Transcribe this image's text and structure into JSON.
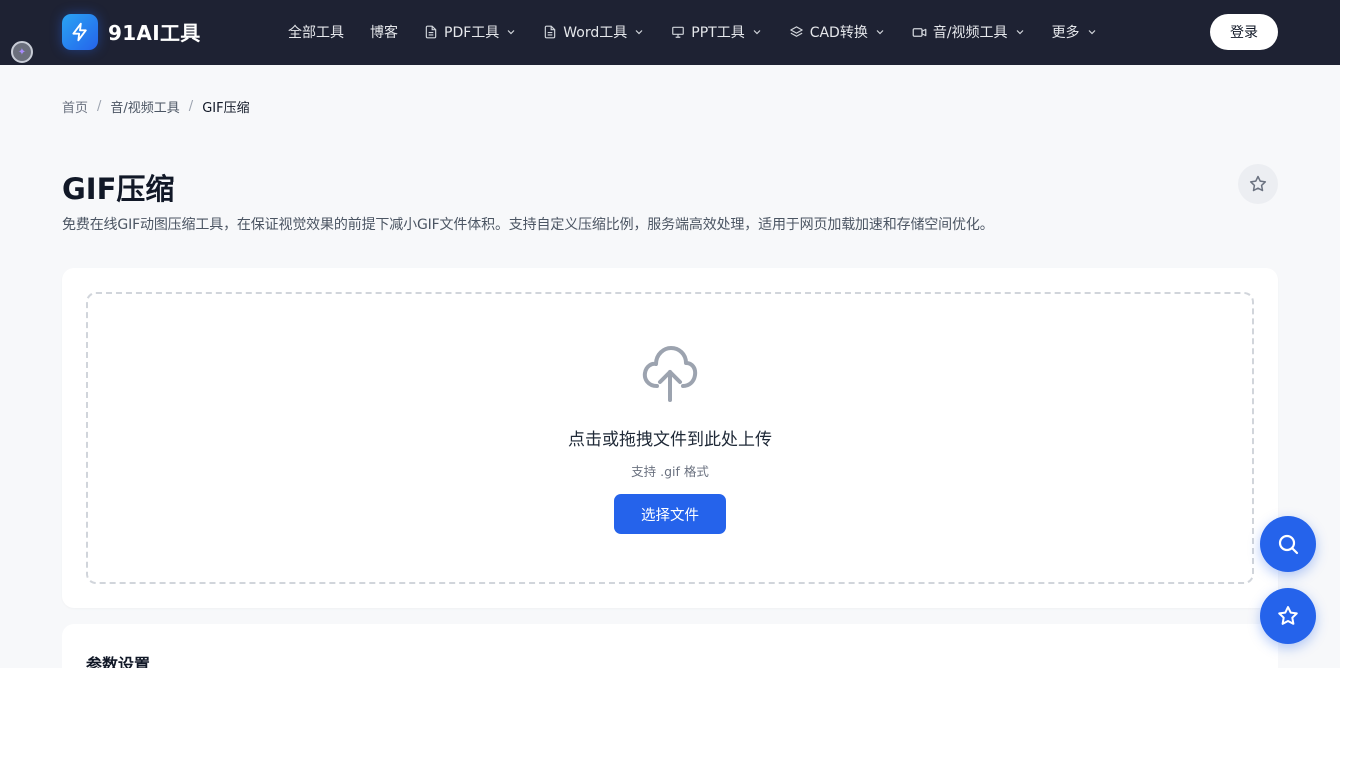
{
  "header": {
    "brand": "91AI工具",
    "nav": [
      {
        "label": "全部工具",
        "icon": null,
        "dropdown": false
      },
      {
        "label": "博客",
        "icon": null,
        "dropdown": false
      },
      {
        "label": "PDF工具",
        "icon": "document-icon",
        "dropdown": true
      },
      {
        "label": "Word工具",
        "icon": "document-icon",
        "dropdown": true
      },
      {
        "label": "PPT工具",
        "icon": "presentation-icon",
        "dropdown": true
      },
      {
        "label": "CAD转换",
        "icon": "layers-icon",
        "dropdown": true
      },
      {
        "label": "音/视频工具",
        "icon": "video-camera-icon",
        "dropdown": true
      },
      {
        "label": "更多",
        "icon": null,
        "dropdown": true
      }
    ],
    "login_label": "登录"
  },
  "breadcrumb": {
    "home": "首页",
    "category": "音/视频工具",
    "current": "GIF压缩",
    "separator": "/"
  },
  "page": {
    "title": "GIF压缩",
    "description": "免费在线GIF动图压缩工具，在保证视觉效果的前提下减小GIF文件体积。支持自定义压缩比例，服务端高效处理，适用于网页加载加速和存储空间优化。"
  },
  "upload": {
    "title": "点击或拖拽文件到此处上传",
    "hint": "支持 .gif 格式",
    "button_label": "选择文件"
  },
  "settings": {
    "title": "参数设置"
  },
  "colors": {
    "header_bg": "#1e2233",
    "accent": "#2563eb",
    "page_bg": "#f7f8fa"
  }
}
